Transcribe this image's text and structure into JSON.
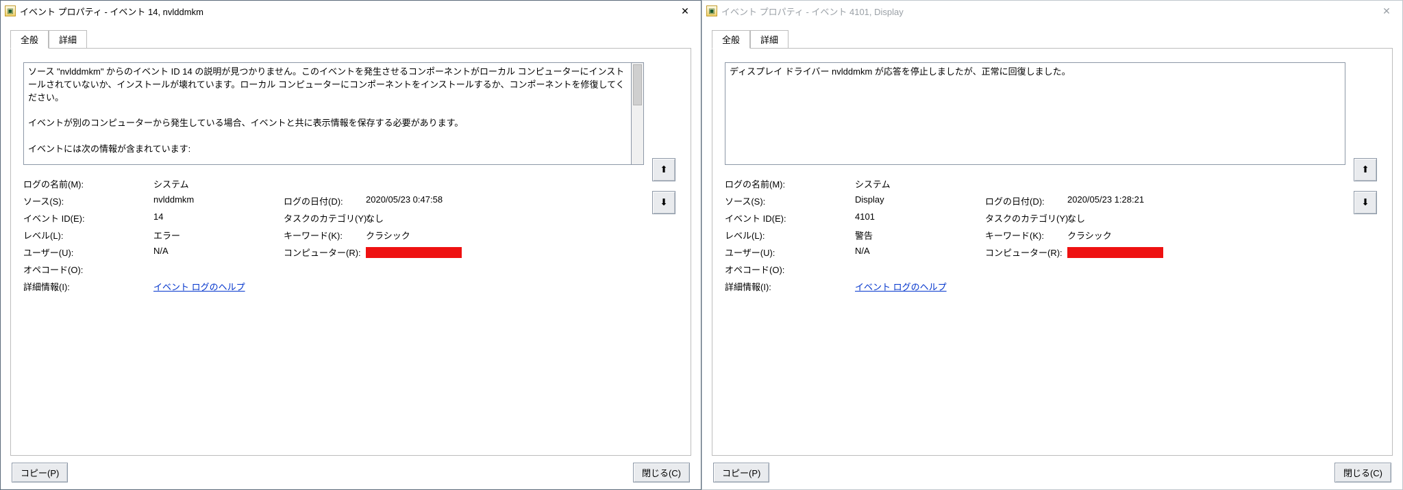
{
  "left": {
    "title": "イベント プロパティ - イベント 14, nvlddmkm",
    "tabs": {
      "general": "全般",
      "details": "詳細"
    },
    "description": "ソース \"nvlddmkm\" からのイベント ID 14 の説明が見つかりません。このイベントを発生させるコンポーネントがローカル コンピューターにインストールされていないか、インストールが壊れています。ローカル コンピューターにコンポーネントをインストールするか、コンポーネントを修復してください。\n\nイベントが別のコンピューターから発生している場合、イベントと共に表示情報を保存する必要があります。\n\nイベントには次の情報が含まれています:",
    "labels": {
      "logName": "ログの名前(M):",
      "source": "ソース(S):",
      "eventId": "イベント ID(E):",
      "level": "レベル(L):",
      "user": "ユーザー(U):",
      "opcode": "オペコード(O):",
      "details": "詳細情報(I):",
      "logDate": "ログの日付(D):",
      "taskCategory": "タスクのカテゴリ(Y):",
      "keywords": "キーワード(K):",
      "computer": "コンピューター(R):"
    },
    "values": {
      "logName": "システム",
      "source": "nvlddmkm",
      "eventId": "14",
      "level": "エラー",
      "user": "N/A",
      "opcode": "",
      "details": "イベント ログのヘルプ",
      "logDate": "2020/05/23 0:47:58",
      "taskCategory": "なし",
      "keywords": "クラシック",
      "computer": ""
    },
    "buttons": {
      "copy": "コピー(P)",
      "close": "閉じる(C)"
    }
  },
  "right": {
    "title": "イベント プロパティ - イベント 4101, Display",
    "tabs": {
      "general": "全般",
      "details": "詳細"
    },
    "description": "ディスプレイ ドライバー nvlddmkm が応答を停止しましたが、正常に回復しました。",
    "labels": {
      "logName": "ログの名前(M):",
      "source": "ソース(S):",
      "eventId": "イベント ID(E):",
      "level": "レベル(L):",
      "user": "ユーザー(U):",
      "opcode": "オペコード(O):",
      "details": "詳細情報(I):",
      "logDate": "ログの日付(D):",
      "taskCategory": "タスクのカテゴリ(Y):",
      "keywords": "キーワード(K):",
      "computer": "コンピューター(R):"
    },
    "values": {
      "logName": "システム",
      "source": "Display",
      "eventId": "4101",
      "level": "警告",
      "user": "N/A",
      "opcode": "",
      "details": "イベント ログのヘルプ",
      "logDate": "2020/05/23 1:28:21",
      "taskCategory": "なし",
      "keywords": "クラシック",
      "computer": ""
    },
    "buttons": {
      "copy": "コピー(P)",
      "close": "閉じる(C)"
    }
  }
}
